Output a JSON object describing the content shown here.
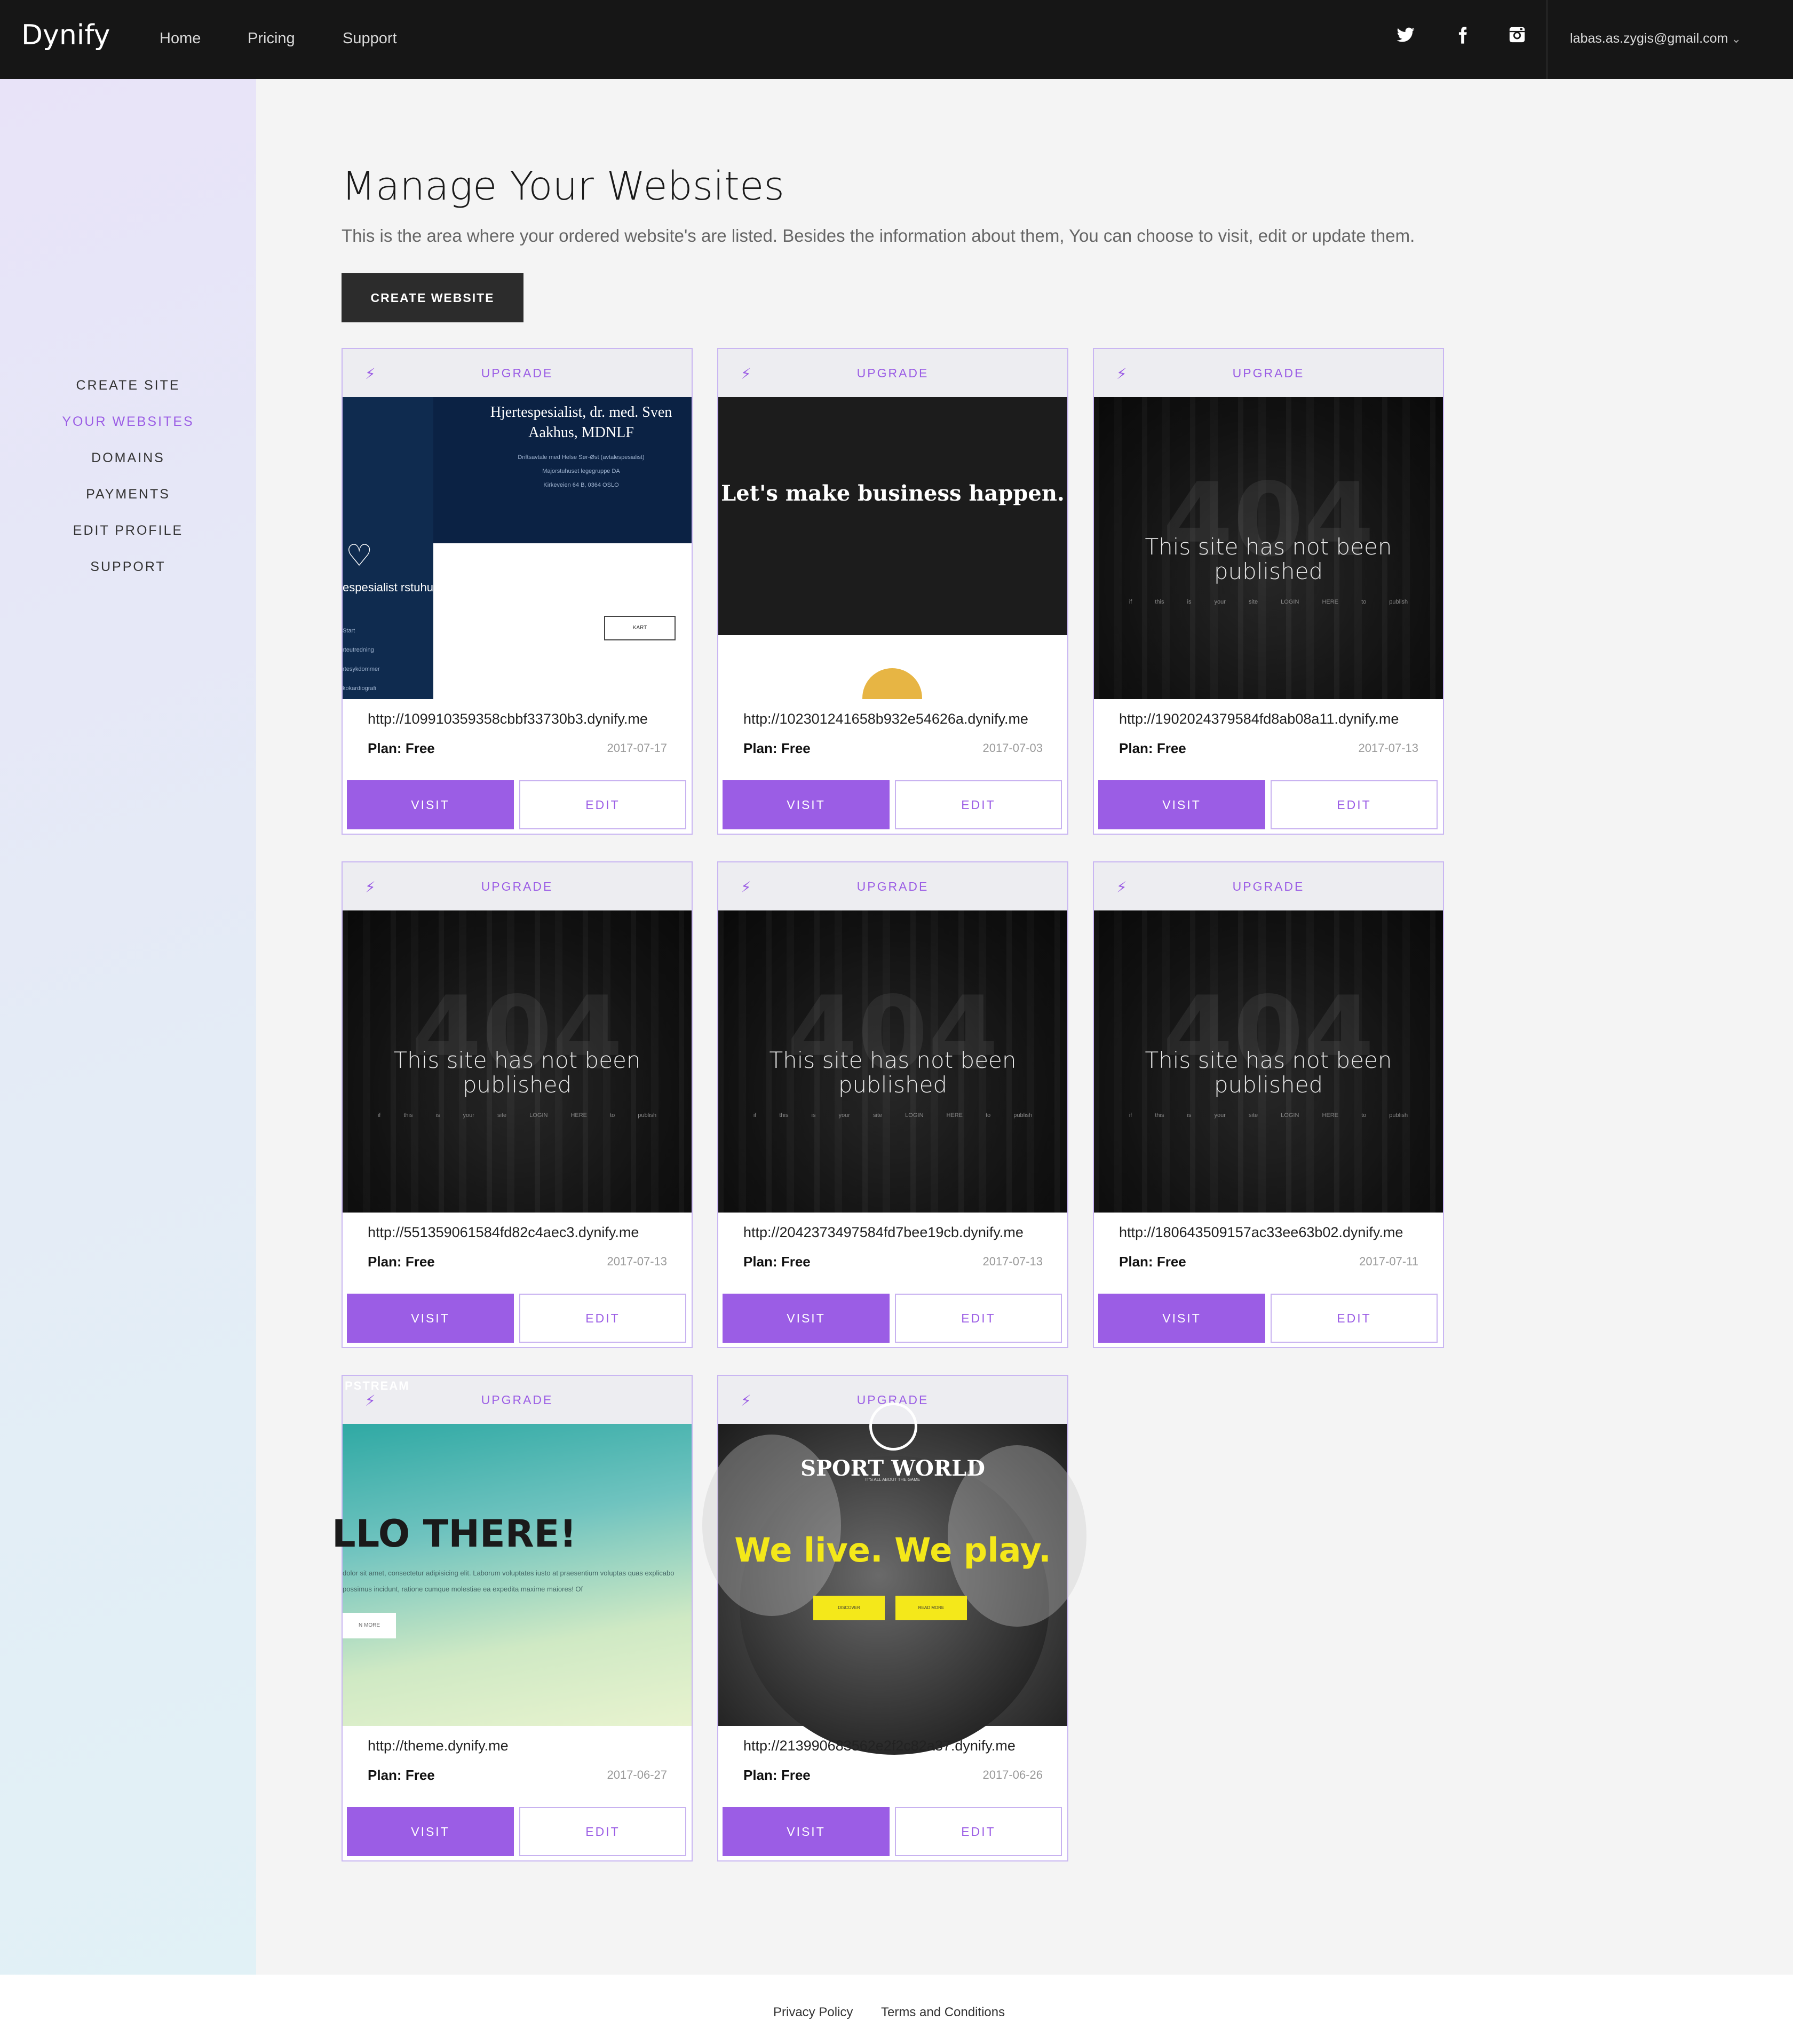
{
  "app": {
    "brand": "Dynify"
  },
  "header": {
    "nav": [
      "Home",
      "Pricing",
      "Support"
    ],
    "social": [
      "twitter-icon",
      "facebook-icon",
      "instagram-icon"
    ],
    "user_email": "labas.as.zygis@gmail.com"
  },
  "sidebar": {
    "items": [
      {
        "label": "CREATE SITE",
        "active": false
      },
      {
        "label": "YOUR WEBSITES",
        "active": true
      },
      {
        "label": "DOMAINS",
        "active": false
      },
      {
        "label": "PAYMENTS",
        "active": false
      },
      {
        "label": "EDIT PROFILE",
        "active": false
      },
      {
        "label": "SUPPORT",
        "active": false
      }
    ]
  },
  "main": {
    "title": "Manage Your Websites",
    "subtitle": "This is the area where your ordered website's are listed. Besides the information about them, You can choose to visit, edit or update them.",
    "create_button": "CREATE WEBSITE"
  },
  "card_labels": {
    "upgrade": "UPGRADE",
    "plan_label": "Plan:",
    "visit": "VISIT",
    "edit": "EDIT"
  },
  "websites": [
    {
      "url": "http://109910359358cbbf33730b3.dynify.me",
      "plan": "Free",
      "date": "2017-07-17",
      "thumb": "doctor"
    },
    {
      "url": "http://102301241658b932e54626a.dynify.me",
      "plan": "Free",
      "date": "2017-07-03",
      "thumb": "business"
    },
    {
      "url": "http://1902024379584fd8ab08a11.dynify.me",
      "plan": "Free",
      "date": "2017-07-13",
      "thumb": "404"
    },
    {
      "url": "http://551359061584fd82c4aec3.dynify.me",
      "plan": "Free",
      "date": "2017-07-13",
      "thumb": "404"
    },
    {
      "url": "http://2042373497584fd7bee19cb.dynify.me",
      "plan": "Free",
      "date": "2017-07-13",
      "thumb": "404"
    },
    {
      "url": "http://180643509157ac33ee63b02.dynify.me",
      "plan": "Free",
      "date": "2017-07-11",
      "thumb": "404"
    },
    {
      "url": "http://theme.dynify.me",
      "plan": "Free",
      "date": "2017-06-27",
      "thumb": "hello"
    },
    {
      "url": "http://213990683562e2f2c82a37.dynify.me",
      "plan": "Free",
      "date": "2017-06-26",
      "thumb": "sport"
    }
  ],
  "thumbnails": {
    "doctor": {
      "heading": "Hjertespesialist, dr. med. Sven Aakhus, MDNLF",
      "lines": [
        "Driftsavtale med Helse Sør-Øst (avtalespesialist)",
        "Majorstuhuset legegruppe DA",
        "Kirkeveien 64 B, 0364 OSLO"
      ],
      "side_text": "espesialist rstuhuset",
      "menu": [
        "Start",
        "rteutredning",
        "rtesykdommer",
        "kokardiografi"
      ],
      "button": "KART"
    },
    "business": {
      "heading": "Let's make business happen."
    },
    "unpublished": {
      "big": "404",
      "message": "This site has not been published",
      "fine": "if this is your site  LOGIN HERE  to publish"
    },
    "hello": {
      "badge": "PSTREAM",
      "heading": "LLO THERE!",
      "body": "dolor sit amet, consectetur adipisicing elit. Laborum voluptates iusto at praesentium voluptas quas explicabo possimus incidunt, ratione cumque molestiae ea expedita maxime maiores! Of",
      "button": "N MORE"
    },
    "sport": {
      "brand": "SPORT WORLD",
      "tagline": "IT'S ALL ABOUT THE GAME",
      "slogan": "We live. We play.",
      "buttons": [
        "DISCOVER",
        "READ MORE"
      ]
    }
  },
  "footer": {
    "links": [
      "Privacy Policy",
      "Terms and Conditions"
    ]
  },
  "colors": {
    "accent": "#9b5de5",
    "topbar": "#161616",
    "button_dark": "#2c2c2c"
  }
}
